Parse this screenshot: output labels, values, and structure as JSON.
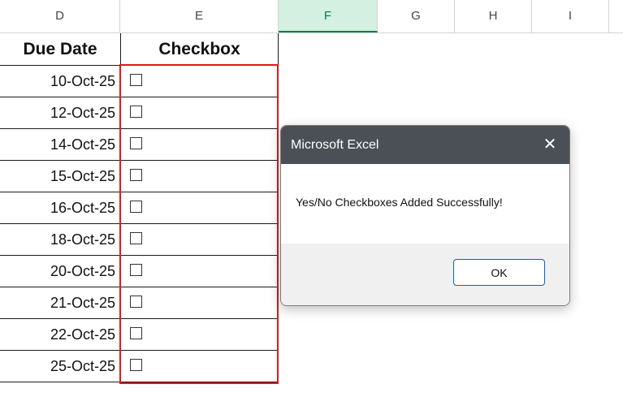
{
  "column_headers": [
    "D",
    "E",
    "F",
    "G",
    "H",
    "I"
  ],
  "selected_column": "F",
  "table": {
    "headers": {
      "due_date": "Due Date",
      "checkbox": "Checkbox"
    },
    "due_dates": [
      "10-Oct-25",
      "12-Oct-25",
      "14-Oct-25",
      "15-Oct-25",
      "16-Oct-25",
      "18-Oct-25",
      "20-Oct-25",
      "21-Oct-25",
      "22-Oct-25",
      "25-Oct-25"
    ]
  },
  "dialog": {
    "title": "Microsoft Excel",
    "message": "Yes/No Checkboxes Added Successfully!",
    "ok_label": "OK"
  },
  "colors": {
    "highlight": "#e2161b",
    "selected_column": "#107c41",
    "titlebar": "#4a5055",
    "ok_border": "#0067c0"
  }
}
